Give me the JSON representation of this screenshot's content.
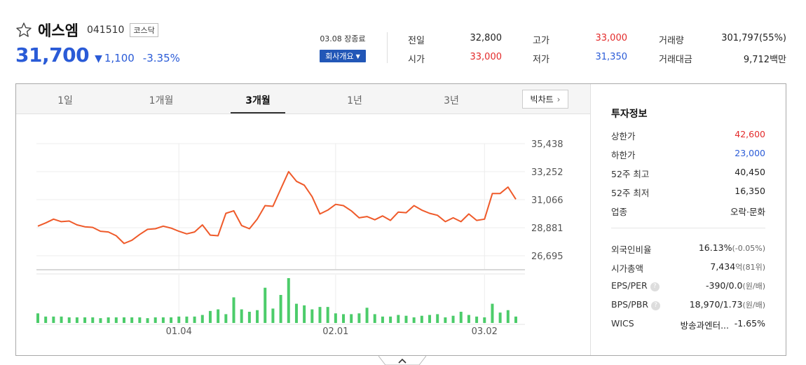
{
  "stock": {
    "name": "에스엠",
    "code": "041510",
    "market": "코스닥",
    "price": "31,700",
    "change": "1,100",
    "change_rate": "-3.35%"
  },
  "session": {
    "label": "03.08 장종료",
    "company_button": "회사개요"
  },
  "quote": {
    "prev_close_label": "전일",
    "prev_close": "32,800",
    "open_label": "시가",
    "open": "33,000",
    "high_label": "고가",
    "high": "33,000",
    "low_label": "저가",
    "low": "31,350",
    "volume_label": "거래량",
    "volume": "301,797(55%)",
    "amount_label": "거래대금",
    "amount": "9,712백만"
  },
  "tabs": [
    {
      "label": "1일"
    },
    {
      "label": "1개월"
    },
    {
      "label": "3개월"
    },
    {
      "label": "1년"
    },
    {
      "label": "3년"
    }
  ],
  "active_tab": 2,
  "big_chart_label": "빅차트",
  "invest": {
    "title": "투자정보",
    "items": [
      {
        "label": "상한가",
        "value": "42,600",
        "color": "#e32a2a"
      },
      {
        "label": "하한가",
        "value": "23,000",
        "color": "#2a5bd7"
      },
      {
        "label": "52주 최고",
        "value": "40,450"
      },
      {
        "label": "52주 최저",
        "value": "16,350"
      },
      {
        "label": "업종",
        "value": "오락·문화"
      }
    ],
    "items2": [
      {
        "label": "외국인비율",
        "value": "16.13%",
        "sub": "(-0.05%)"
      },
      {
        "label": "시가총액",
        "value": "7,434",
        "sub": "억(81위)"
      },
      {
        "label": "EPS/PER",
        "value": "-390/0.0",
        "sub": "(원/배)",
        "help": "?"
      },
      {
        "label": "BPS/PBR",
        "value": "18,970/1.73",
        "sub": "(원/배)",
        "help": "?"
      },
      {
        "label": "WICS",
        "value": "방송과엔터...",
        "extra": "-1.65%"
      }
    ]
  },
  "colors": {
    "price_line": "#ef5a2a",
    "volume_bar": "#4ccc6a",
    "down": "#2a5bd7",
    "up": "#e32a2a"
  },
  "chart_data": {
    "type": "line",
    "y_ticks": [
      "35,438",
      "33,252",
      "31,066",
      "28,881",
      "26,695"
    ],
    "y_tick_values": [
      35438,
      33252,
      31066,
      28881,
      26695
    ],
    "ylim": [
      26695,
      35438
    ],
    "x_ticks": [
      {
        "label": "01.04",
        "index": 18
      },
      {
        "label": "02.01",
        "index": 38
      },
      {
        "label": "03.02",
        "index": 57
      }
    ],
    "price": [
      29000,
      29250,
      29550,
      29350,
      29400,
      29100,
      28950,
      28900,
      28600,
      28550,
      28250,
      27650,
      27900,
      28350,
      28750,
      28800,
      29000,
      28850,
      28600,
      28400,
      28550,
      29100,
      28300,
      28250,
      30000,
      30200,
      29050,
      28800,
      29550,
      30600,
      30550,
      31900,
      33250,
      32500,
      32200,
      31300,
      29950,
      30250,
      30700,
      30600,
      30200,
      29650,
      29750,
      29500,
      29800,
      29450,
      30100,
      30050,
      30600,
      30250,
      30000,
      29850,
      29350,
      29650,
      29350,
      29950,
      29450,
      29550,
      31550,
      31550,
      32050,
      31100
    ],
    "volume": [
      12,
      8,
      8,
      8,
      7,
      7,
      7,
      7,
      6,
      7,
      7,
      7,
      7,
      7,
      6,
      7,
      7,
      7,
      8,
      8,
      8,
      10,
      15,
      17,
      11,
      32,
      17,
      14,
      16,
      44,
      18,
      35,
      56,
      24,
      22,
      17,
      20,
      20,
      12,
      11,
      11,
      12,
      19,
      11,
      8,
      8,
      10,
      9,
      7,
      9,
      10,
      11,
      7,
      9,
      14,
      10,
      8,
      7,
      24,
      13,
      16,
      8
    ]
  }
}
